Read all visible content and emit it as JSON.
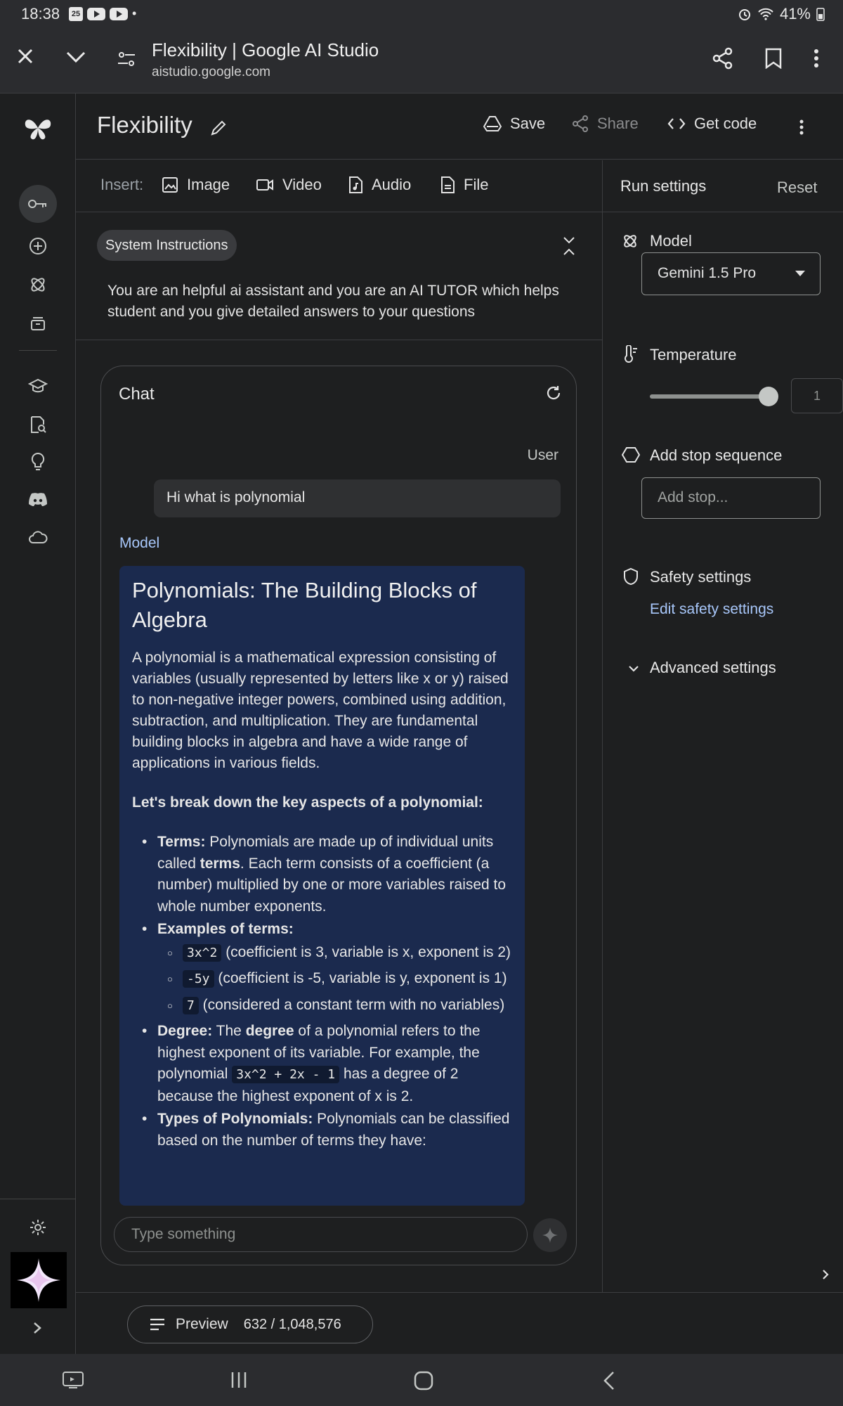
{
  "status_bar": {
    "time": "18:38",
    "cal_day": "25",
    "battery": "41%"
  },
  "browser": {
    "page_title": "Flexibility | Google AI Studio",
    "url": "aistudio.google.com"
  },
  "header": {
    "title": "Flexibility",
    "save": "Save",
    "share": "Share",
    "get_code": "Get code"
  },
  "insert": {
    "label": "Insert:",
    "image": "Image",
    "video": "Video",
    "audio": "Audio",
    "file": "File"
  },
  "system_instructions": {
    "label": "System Instructions",
    "text": "You are an helpful ai assistant and you are an AI TUTOR which helps student and you give detailed answers to your questions"
  },
  "chat": {
    "title": "Chat",
    "user_label": "User",
    "user_message": "Hi what is polynomial",
    "model_label": "Model",
    "response": {
      "heading": "Polynomials: The Building Blocks of Algebra",
      "intro": "A polynomial is a mathematical expression consisting of variables (usually represented by letters like x or y) raised to non-negative integer powers, combined using addition, subtraction, and multiplication. They are fundamental building blocks in algebra and have a wide range of applications in various fields.",
      "section": "Let's break down the key aspects of a polynomial:",
      "terms_label": "Terms:",
      "terms_text_1": " Polynomials are made up of individual units called ",
      "terms_bold": "terms",
      "terms_text_2": ". Each term consists of a coefficient (a number) multiplied by one or more variables raised to whole number exponents.",
      "examples_label": "Examples of terms:",
      "ex1_code": "3x^2",
      "ex1_text": " (coefficient is 3, variable is x, exponent is 2)",
      "ex2_code": "-5y",
      "ex2_text": " (coefficient is -5, variable is y, exponent is 1)",
      "ex3_code": "7",
      "ex3_text": " (considered a constant term with no variables)",
      "degree_label": "Degree:",
      "degree_text_1": " The ",
      "degree_bold": "degree",
      "degree_text_2": " of a polynomial refers to the highest exponent of its variable. For example, the polynomial ",
      "degree_code": "3x^2 + 2x - 1",
      "degree_text_3": " has a degree of 2 because the highest exponent of x is 2.",
      "types_label": "Types of Polynomials:",
      "types_text": " Polynomials can be classified based on the number of terms they have:"
    },
    "input_placeholder": "Type something"
  },
  "run_settings": {
    "title": "Run settings",
    "reset": "Reset",
    "model_label": "Model",
    "model_value": "Gemini 1.5 Pro",
    "temperature_label": "Temperature",
    "temperature_value": "1",
    "temperature_level": 1.0,
    "stop_label": "Add stop sequence",
    "stop_placeholder": "Add stop...",
    "safety_label": "Safety settings",
    "safety_link": "Edit safety settings",
    "advanced_label": "Advanced settings"
  },
  "footer": {
    "preview_label": "Preview",
    "token_count": "632 / 1,048,576"
  },
  "colors": {
    "accent": "#a8c7fa",
    "bubble": "#1b2a4e",
    "background": "#1e1f20"
  }
}
